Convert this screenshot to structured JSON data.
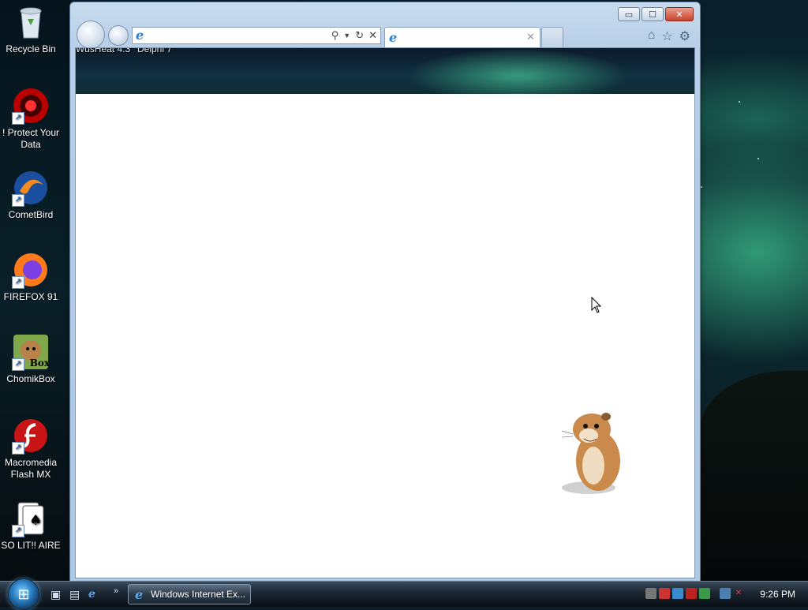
{
  "desktop": {
    "icons": [
      {
        "label": "Recycle Bin",
        "icon": "recycle-bin-icon"
      },
      {
        "label": "! Protect Your Data",
        "icon": "protect-data-icon"
      },
      {
        "label": "CometBird",
        "icon": "cometbird-icon"
      },
      {
        "label": "FIREFOX 91",
        "icon": "firefox-icon"
      },
      {
        "label": "ChomikBox",
        "icon": "chomikbox-icon",
        "badge": "Box"
      },
      {
        "label": "Macromedia Flash MX",
        "icon": "flash-icon"
      },
      {
        "label": "SO LIT!! AIRE",
        "icon": "solitaire-icon"
      }
    ]
  },
  "browser": {
    "title_controls": {
      "minimize": "▭",
      "maximize": "☐",
      "close": "✕"
    },
    "address_value": "",
    "tab_title": "",
    "page_banner": {
      "left_text": "WusHeat 4.3",
      "right_text": "Delphi 7"
    }
  },
  "taskbar": {
    "task_label": "Windows Internet Ex...",
    "clock": "9:26 PM"
  },
  "colors": {
    "accent": "#2a7fd0",
    "close": "#c8432c"
  }
}
